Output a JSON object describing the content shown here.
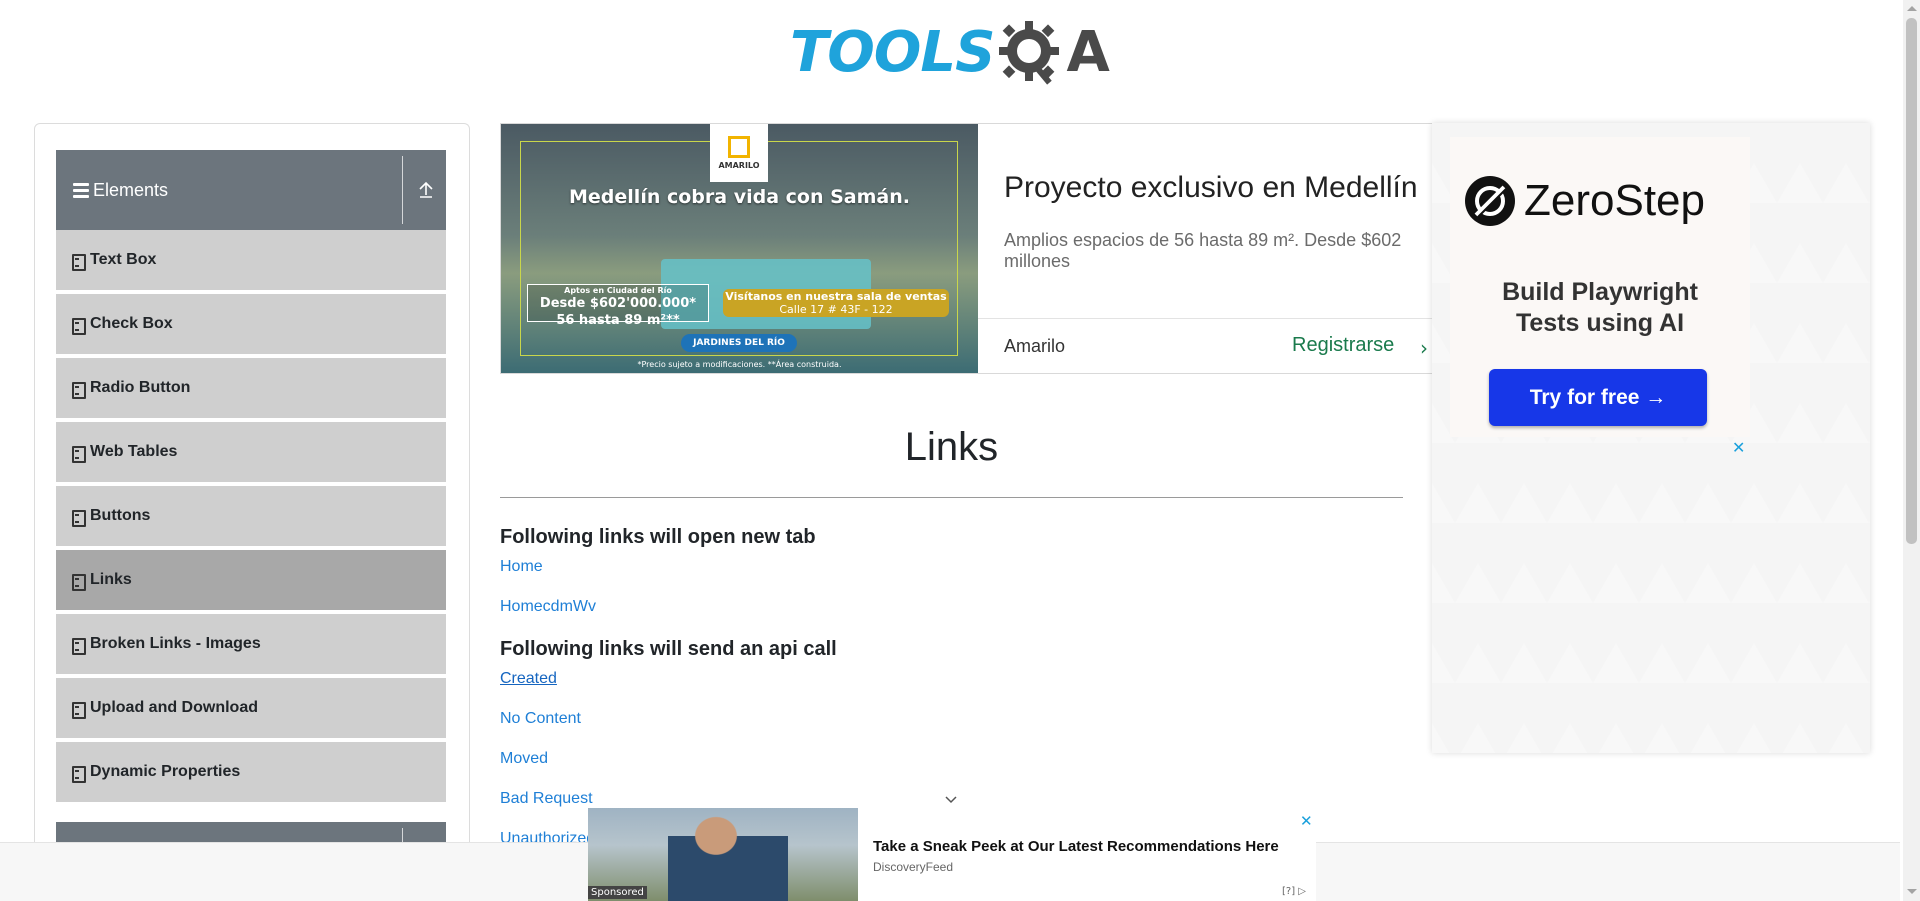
{
  "header": {
    "logo_text": "TOOLS",
    "logo_a": "A"
  },
  "sidebar": {
    "group_title": "Elements",
    "items": [
      {
        "label": "Text Box",
        "active": false
      },
      {
        "label": "Check Box",
        "active": false
      },
      {
        "label": "Radio Button",
        "active": false
      },
      {
        "label": "Web Tables",
        "active": false
      },
      {
        "label": "Buttons",
        "active": false
      },
      {
        "label": "Links",
        "active": true
      },
      {
        "label": "Broken Links - Images",
        "active": false
      },
      {
        "label": "Upload and Download",
        "active": false
      },
      {
        "label": "Dynamic Properties",
        "active": false
      }
    ]
  },
  "banner_ad": {
    "brand_logo": "AMARILO",
    "headline": "Medellín cobra vida con Samán.",
    "box1_small": "Aptos en Ciudad del Río",
    "box1_line1": "Desde $602'000.000*",
    "box1_line2": "56 hasta 89 m²**",
    "box2_line1": "Visítanos en nuestra sala de ventas",
    "box2_line2": "Calle 17 # 43F - 122",
    "pill": "JARDINES DEL RÍO",
    "footnote": "*Precio sujeto a modificaciones. **Área construida.",
    "title": "Proyecto exclusivo en Medellín",
    "description": "Amplios espacios de 56 hasta 89 m². Desde $602 millones",
    "advertiser": "Amarilo",
    "cta": "Registrarse"
  },
  "main": {
    "title": "Links",
    "section1": "Following links will open new tab",
    "links_new_tab": [
      "Home",
      "HomecdmWv"
    ],
    "section2": "Following links will send an api call",
    "api_links": [
      "Created",
      "No Content",
      "Moved",
      "Bad Request",
      "Unauthorized"
    ]
  },
  "right_ad": {
    "brand": "ZeroStep",
    "tagline_line1": "Build Playwright",
    "tagline_line2": "Tests using AI",
    "button": "Try for free →",
    "close": "✕"
  },
  "bottom_ad": {
    "title": "Take a Sneak Peek at Our Latest Recommendations Here",
    "source": "DiscoveryFeed",
    "sponsored": "Sponsored",
    "info": "[?]",
    "close": "✕"
  },
  "colors": {
    "accent_blue": "#1fa3db",
    "sidebar_header": "#6c757d",
    "menu_item_bg": "#cfcfcf",
    "menu_item_active": "#a8a8a8",
    "link_blue": "#1e7fd6",
    "cta_green": "#1a7a4c",
    "zerostep_button": "#1737e8"
  }
}
